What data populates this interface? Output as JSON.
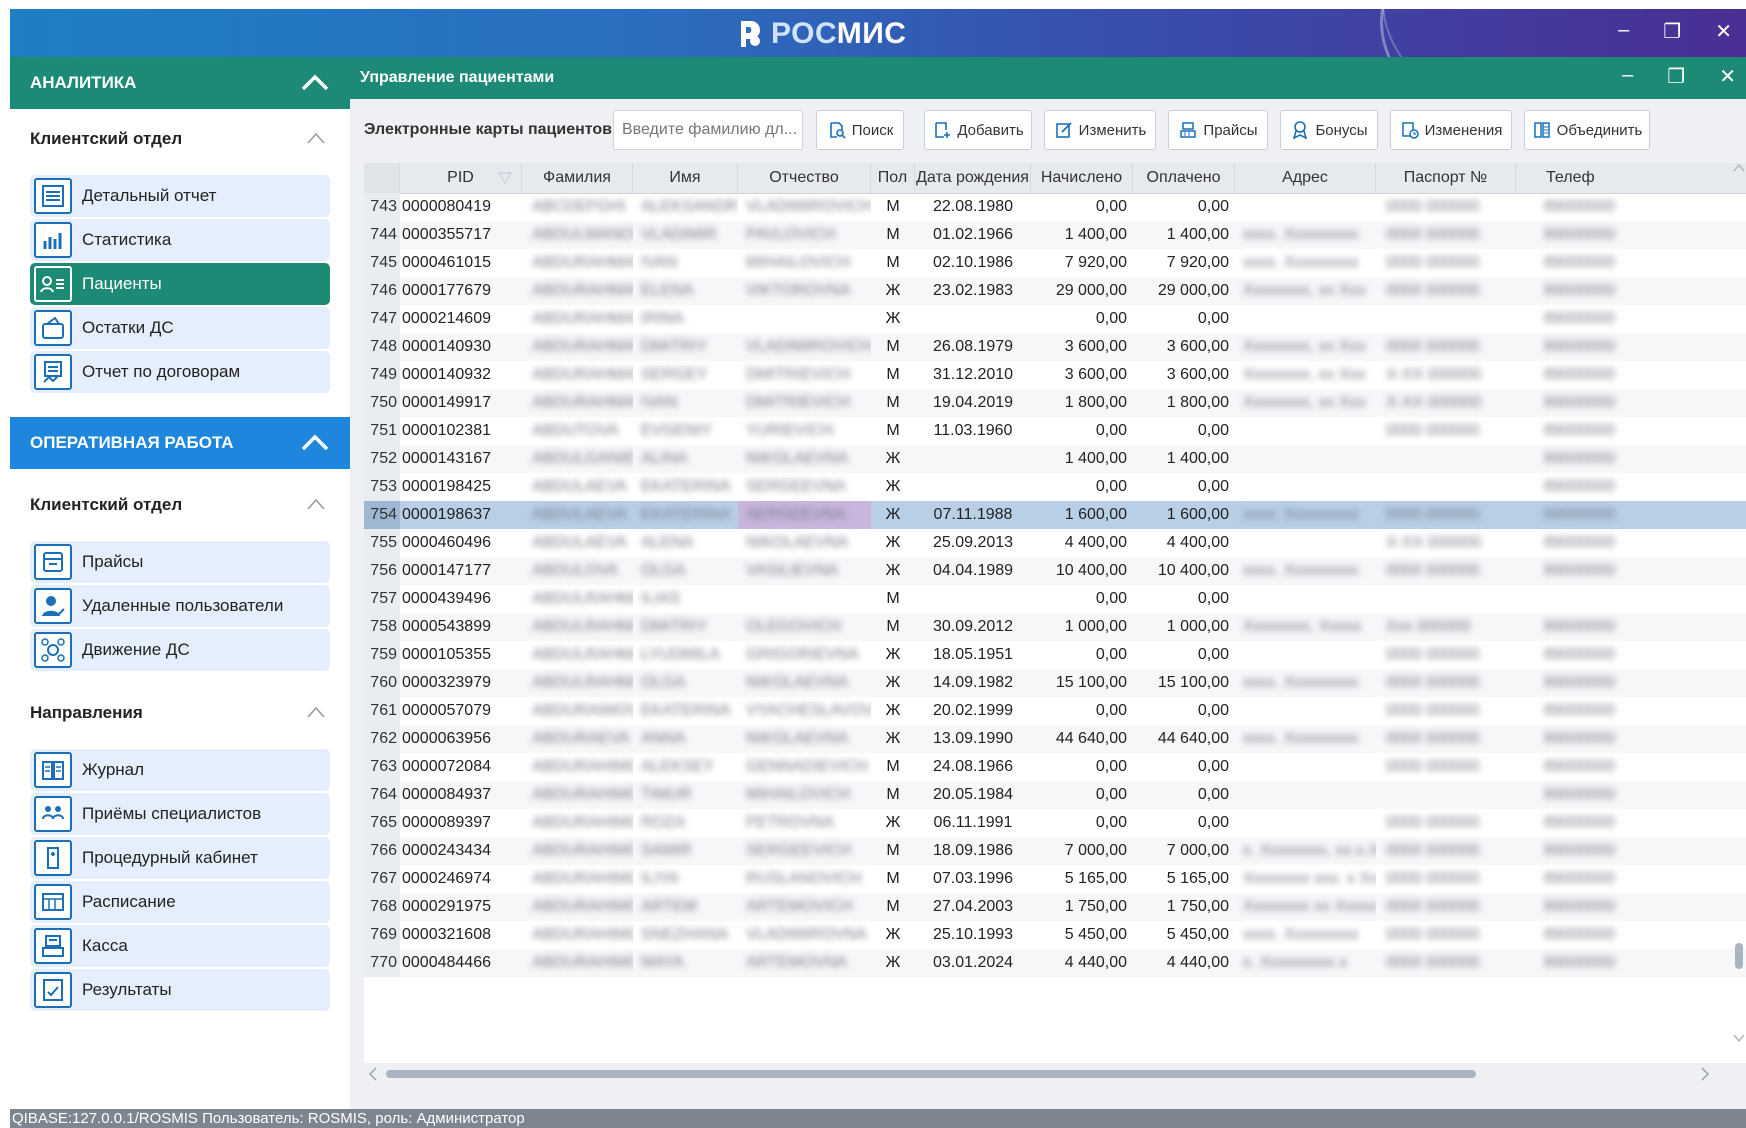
{
  "app": {
    "logo_prefix": "РОС",
    "logo_suffix": "МИС"
  },
  "sidebar": {
    "analytics": {
      "header": "АНАЛИТИКА",
      "group_title": "Клиентский отдел",
      "items": [
        {
          "label": "Детальный отчет",
          "icon": "report-icon"
        },
        {
          "label": "Статистика",
          "icon": "statistics-icon"
        },
        {
          "label": "Пациенты",
          "icon": "patients-icon",
          "active": true
        },
        {
          "label": "Остатки ДС",
          "icon": "balance-icon"
        },
        {
          "label": "Отчет по договорам",
          "icon": "contracts-icon"
        }
      ]
    },
    "operations": {
      "header": "ОПЕРАТИВНАЯ РАБОТА",
      "group1_title": "Клиентский отдел",
      "group1_items": [
        {
          "label": "Прайсы",
          "icon": "price-icon"
        },
        {
          "label": "Удаленные пользователи",
          "icon": "remote-user-icon"
        },
        {
          "label": "Движение ДС",
          "icon": "money-flow-icon"
        }
      ],
      "group2_title": "Направления",
      "group2_items": [
        {
          "label": "Журнал",
          "icon": "journal-icon"
        },
        {
          "label": "Приёмы специалистов",
          "icon": "specialists-icon"
        },
        {
          "label": "Процедурный кабинет",
          "icon": "procedure-icon"
        },
        {
          "label": "Расписание",
          "icon": "schedule-icon"
        },
        {
          "label": "Касса",
          "icon": "cashbox-icon"
        },
        {
          "label": "Результаты",
          "icon": "results-icon"
        }
      ]
    }
  },
  "content": {
    "title": "Управление пациентами",
    "toolbar": {
      "label": "Электронные карты пациентов",
      "search_placeholder": "Введите фамилию дл...",
      "buttons": [
        "Поиск",
        "Добавить",
        "Изменить",
        "Прайсы",
        "Бонусы",
        "Изменения",
        "Объединить"
      ]
    },
    "columns": [
      "PID",
      "Фамилия",
      "Имя",
      "Отчество",
      "Пол",
      "Дата рождения",
      "Начислено",
      "Оплачено",
      "Адрес",
      "Паспорт №",
      "Телеф"
    ],
    "rows": [
      {
        "n": "743",
        "pid": "0000080419",
        "fam": "ABCDEFGHI",
        "name": "ALEKSANDR",
        "otch": "VLADIMIROVICH",
        "pol": "М",
        "dob": "22.08.1980",
        "nach": "0,00",
        "opl": "0,00",
        "addr": "",
        "pass": "0000 000000",
        "tel": "89000000"
      },
      {
        "n": "744",
        "pid": "0000355717",
        "fam": "ABDULMANOVA",
        "name": "VLADIMIR",
        "otch": "PAVLOVICH",
        "pol": "М",
        "dob": "01.02.1966",
        "nach": "1 400,00",
        "opl": "1 400,00",
        "addr": "xxxx. Xxxxxxxxx",
        "pass": "0000 000000",
        "tel": "89000000"
      },
      {
        "n": "745",
        "pid": "0000461015",
        "fam": "ABDURAHMANOV",
        "name": "IVAN",
        "otch": "MIHAILOVICH",
        "pol": "М",
        "dob": "02.10.1986",
        "nach": "7 920,00",
        "opl": "7 920,00",
        "addr": "xxxx. Xxxxxxxxx",
        "pass": "0000 000000",
        "tel": "89000000"
      },
      {
        "n": "746",
        "pid": "0000177679",
        "fam": "ABDURAHMANOVA",
        "name": "ELENA",
        "otch": "VIKTOROVNA",
        "pol": "Ж",
        "dob": "23.02.1983",
        "nach": "29 000,00",
        "opl": "29 000,00",
        "addr": "Xxxxxxxx, xx Xxx",
        "pass": "0000 000000",
        "tel": "89000000"
      },
      {
        "n": "747",
        "pid": "0000214609",
        "fam": "ABDURAHMANOVA",
        "name": "IRINA",
        "otch": "",
        "pol": "Ж",
        "dob": "",
        "nach": "0,00",
        "opl": "0,00",
        "addr": "",
        "pass": "",
        "tel": "89000000"
      },
      {
        "n": "748",
        "pid": "0000140930",
        "fam": "ABDURAHMANOV",
        "name": "DMITRIY",
        "otch": "VLADIMIROVICH",
        "pol": "М",
        "dob": "26.08.1979",
        "nach": "3 600,00",
        "opl": "3 600,00",
        "addr": "Xxxxxxxx, xx Xxx",
        "pass": "0000 000000",
        "tel": "89000000"
      },
      {
        "n": "749",
        "pid": "0000140932",
        "fam": "ABDURAHMANOV",
        "name": "SERGEY",
        "otch": "DMITRIEVICH",
        "pol": "М",
        "dob": "31.12.2010",
        "nach": "3 600,00",
        "opl": "3 600,00",
        "addr": "Xxxxxxxx, xx Xxx",
        "pass": "X-XX 000000",
        "tel": "89000000"
      },
      {
        "n": "750",
        "pid": "0000149917",
        "fam": "ABDURAHMANOV",
        "name": "IVAN",
        "otch": "DMITRIEVICH",
        "pol": "М",
        "dob": "19.04.2019",
        "nach": "1 800,00",
        "opl": "1 800,00",
        "addr": "Xxxxxxxx, xx Xxx",
        "pass": "X-XX 000000",
        "tel": "89000000"
      },
      {
        "n": "751",
        "pid": "0000102381",
        "fam": "ABDUTOVA",
        "name": "EVGENIY",
        "otch": "YURIEVICH",
        "pol": "М",
        "dob": "11.03.1960",
        "nach": "0,00",
        "opl": "0,00",
        "addr": "",
        "pass": "0000 000000",
        "tel": "89000000"
      },
      {
        "n": "752",
        "pid": "0000143167",
        "fam": "ABDULGANIEVA",
        "name": "ALINA",
        "otch": "NIKOLAEVNA",
        "pol": "Ж",
        "dob": "",
        "nach": "1 400,00",
        "opl": "1 400,00",
        "addr": "",
        "pass": "",
        "tel": "89000000"
      },
      {
        "n": "753",
        "pid": "0000198425",
        "fam": "ABDULAEVA",
        "name": "EKATERINA",
        "otch": "SERGEEVNA",
        "pol": "Ж",
        "dob": "",
        "nach": "0,00",
        "opl": "0,00",
        "addr": "",
        "pass": "",
        "tel": "89000000"
      },
      {
        "n": "754",
        "pid": "0000198637",
        "fam": "ABDULAEVA",
        "name": "EKATERINA",
        "otch": "SERGEEVNA",
        "pol": "Ж",
        "dob": "07.11.1988",
        "nach": "1 600,00",
        "opl": "1 600,00",
        "addr": "xxxx. Xxxxxxxxx",
        "pass": "0000 000000",
        "tel": "89000000",
        "selected": true
      },
      {
        "n": "755",
        "pid": "0000460496",
        "fam": "ABDULAEVA",
        "name": "ALENA",
        "otch": "NIKOLAEVNA",
        "pol": "Ж",
        "dob": "25.09.2013",
        "nach": "4 400,00",
        "opl": "4 400,00",
        "addr": "",
        "pass": "X-XX 000000",
        "tel": "89000000"
      },
      {
        "n": "756",
        "pid": "0000147177",
        "fam": "ABDULOVA",
        "name": "OLGA",
        "otch": "VASILIEVNA",
        "pol": "Ж",
        "dob": "04.04.1989",
        "nach": "10 400,00",
        "opl": "10 400,00",
        "addr": "xxxx. Xxxxxxxxx",
        "pass": "0000 000000",
        "tel": "89000000"
      },
      {
        "n": "757",
        "pid": "0000439496",
        "fam": "ABDULRAHMAN",
        "name": "ILIAS",
        "otch": "",
        "pol": "М",
        "dob": "",
        "nach": "0,00",
        "opl": "0,00",
        "addr": "",
        "pass": "",
        "tel": ""
      },
      {
        "n": "758",
        "pid": "0000543899",
        "fam": "ABDULRAHMANOV",
        "name": "DMITRIY",
        "otch": "OLEGOVICH",
        "pol": "М",
        "dob": "30.09.2012",
        "nach": "1 000,00",
        "opl": "1 000,00",
        "addr": "Xxxxxxxx, Xxxxx",
        "pass": "Xxx 000000",
        "tel": "89000000"
      },
      {
        "n": "759",
        "pid": "0000105355",
        "fam": "ABDULRAHMANOVA",
        "name": "LYUDMILA",
        "otch": "GRIGORIEVNA",
        "pol": "Ж",
        "dob": "18.05.1951",
        "nach": "0,00",
        "opl": "0,00",
        "addr": "",
        "pass": "0000 000000",
        "tel": "89000000"
      },
      {
        "n": "760",
        "pid": "0000323979",
        "fam": "ABDULRAHMANOVA",
        "name": "OLGA",
        "otch": "NIKOLAEVNA",
        "pol": "Ж",
        "dob": "14.09.1982",
        "nach": "15 100,00",
        "opl": "15 100,00",
        "addr": "xxxx. Xxxxxxxxx",
        "pass": "0000 000000",
        "tel": "89000000"
      },
      {
        "n": "761",
        "pid": "0000057079",
        "fam": "ABDURAIMOVA",
        "name": "EKATERINA",
        "otch": "VYACHESLAVOVNA",
        "pol": "Ж",
        "dob": "20.02.1999",
        "nach": "0,00",
        "opl": "0,00",
        "addr": "",
        "pass": "0000 000000",
        "tel": "89000000"
      },
      {
        "n": "762",
        "pid": "0000063956",
        "fam": "ABDURAEVA",
        "name": "ANNA",
        "otch": "NIKOLAEVNA",
        "pol": "Ж",
        "dob": "13.09.1990",
        "nach": "44 640,00",
        "opl": "44 640,00",
        "addr": "xxxx. Xxxxxxxxx",
        "pass": "0000 000000",
        "tel": "89000000"
      },
      {
        "n": "763",
        "pid": "0000072084",
        "fam": "ABDURAHIMOV",
        "name": "ALEKSEY",
        "otch": "GENNADIEVICH",
        "pol": "М",
        "dob": "24.08.1966",
        "nach": "0,00",
        "opl": "0,00",
        "addr": "",
        "pass": "0000 000000",
        "tel": "89000000"
      },
      {
        "n": "764",
        "pid": "0000084937",
        "fam": "ABDURAHIMOV",
        "name": "TIMUR",
        "otch": "MIHAILOVICH",
        "pol": "М",
        "dob": "20.05.1984",
        "nach": "0,00",
        "opl": "0,00",
        "addr": "",
        "pass": "",
        "tel": "89000000"
      },
      {
        "n": "765",
        "pid": "0000089397",
        "fam": "ABDURAHIMOVA",
        "name": "ROZA",
        "otch": "PETROVNA",
        "pol": "Ж",
        "dob": "06.11.1991",
        "nach": "0,00",
        "opl": "0,00",
        "addr": "",
        "pass": "0000 000000",
        "tel": "89000000"
      },
      {
        "n": "766",
        "pid": "0000243434",
        "fam": "ABDURAHIMOV",
        "name": "SAMIR",
        "otch": "SERGEEVICH",
        "pol": "М",
        "dob": "18.09.1986",
        "nach": "7 000,00",
        "opl": "7 000,00",
        "addr": "x. Xxxxxxxx, xx.x.X",
        "pass": "0000 000000",
        "tel": "89000000"
      },
      {
        "n": "767",
        "pid": "0000246974",
        "fam": "ABDURAHIMOV",
        "name": "ILIYA",
        "otch": "RUSLANOVICH",
        "pol": "М",
        "dob": "07.03.1996",
        "nach": "5 165,00",
        "opl": "5 165,00",
        "addr": "Xxxxxxxx xxx. x Xx",
        "pass": "0000 000000",
        "tel": "89000000"
      },
      {
        "n": "768",
        "pid": "0000291975",
        "fam": "ABDURAHIMOV",
        "name": "ARTEM",
        "otch": "ARTEMOVICH",
        "pol": "М",
        "dob": "27.04.2003",
        "nach": "1 750,00",
        "opl": "1 750,00",
        "addr": "Xxxxxxxx xx Xxxxx",
        "pass": "0000 000000",
        "tel": "89000000"
      },
      {
        "n": "769",
        "pid": "0000321608",
        "fam": "ABDURAHIMOVA",
        "name": "SNEZHANA",
        "otch": "VLADIMIROVNA",
        "pol": "Ж",
        "dob": "25.10.1993",
        "nach": "5 450,00",
        "opl": "5 450,00",
        "addr": "xxxx. Xxxxxxxxx",
        "pass": "0000 000000",
        "tel": "89000000"
      },
      {
        "n": "770",
        "pid": "0000484466",
        "fam": "ABDURAHIMOVA",
        "name": "MAYA",
        "otch": "ARTEMOVNA",
        "pol": "Ж",
        "dob": "03.01.2024",
        "nach": "4 440,00",
        "opl": "4 440,00",
        "addr": "x. Xxxxxxxxx x",
        "pass": "0000 000000",
        "tel": "89000000"
      }
    ]
  },
  "status": {
    "text": "QIBASE:127.0.0.1/ROSMIS  Пользователь: ROSMIS, роль: Администратор"
  },
  "colors": {
    "teal": "#1c8a74",
    "blue": "#1e7fc4",
    "purple": "#4a2e93",
    "selected_row": "#b8cfe6"
  }
}
